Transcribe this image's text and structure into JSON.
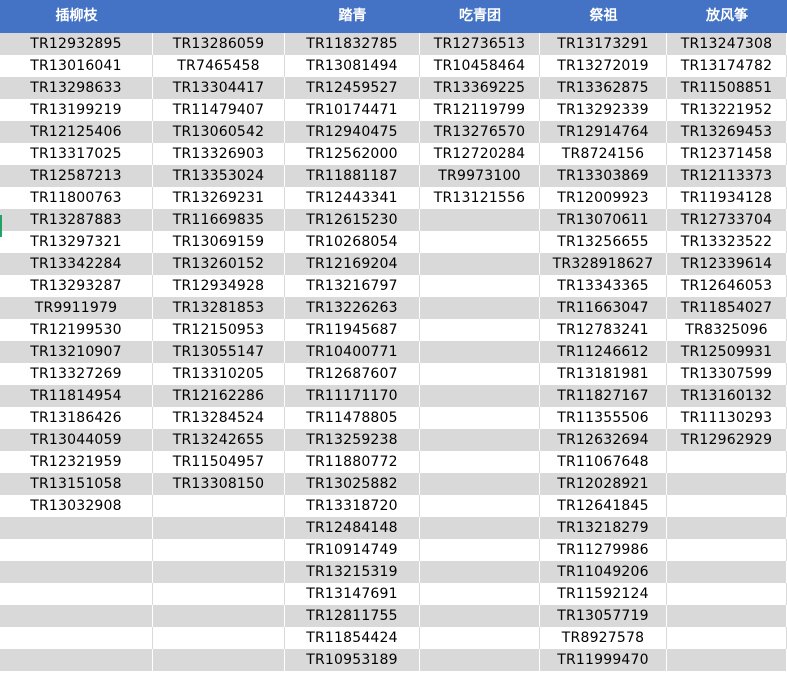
{
  "sheet": {
    "headers": [
      "插柳枝",
      "",
      "踏青",
      "吃青团",
      "祭祖",
      "放风筝"
    ],
    "columns": [
      [
        "TR12932895",
        "TR13016041",
        "TR13298633",
        "TR13199219",
        "TR12125406",
        "TR13317025",
        "TR12587213",
        "TR11800763",
        "TR13287883",
        "TR13297321",
        "TR13342284",
        "TR13293287",
        "TR9911979",
        "TR12199530",
        "TR13210907",
        "TR13327269",
        "TR11814954",
        "TR13186426",
        "TR13044059",
        "TR12321959",
        "TR13151058",
        "TR13032908"
      ],
      [
        "TR13286059",
        "TR7465458",
        "TR13304417",
        "TR11479407",
        "TR13060542",
        "TR13326903",
        "TR13353024",
        "TR13269231",
        "TR11669835",
        "TR13069159",
        "TR13260152",
        "TR12934928",
        "TR13281853",
        "TR12150953",
        "TR13055147",
        "TR13310205",
        "TR12162286",
        "TR13284524",
        "TR13242655",
        "TR11504957",
        "TR13308150"
      ],
      [
        "TR11832785",
        "TR13081494",
        "TR12459527",
        "TR10174471",
        "TR12940475",
        "TR12562000",
        "TR11881187",
        "TR12443341",
        "TR12615230",
        "TR10268054",
        "TR12169204",
        "TR13216797",
        "TR13226263",
        "TR11945687",
        "TR10400771",
        "TR12687607",
        "TR11171170",
        "TR11478805",
        "TR13259238",
        "TR11880772",
        "TR13025882",
        "TR13318720",
        "TR12484148",
        "TR10914749",
        "TR13215319",
        "TR13147691",
        "TR12811755",
        "TR11854424",
        "TR10953189"
      ],
      [
        "TR12736513",
        "TR10458464",
        "TR13369225",
        "TR12119799",
        "TR13276570",
        "TR12720284",
        "TR9973100",
        "TR13121556"
      ],
      [
        "TR13173291",
        "TR13272019",
        "TR13362875",
        "TR13292339",
        "TR12914764",
        "TR8724156",
        "TR13303869",
        "TR12009923",
        "TR13070611",
        "TR13256655",
        "TR328918627",
        "TR13343365",
        "TR11663047",
        "TR12783241",
        "TR11246612",
        "TR13181981",
        "TR11827167",
        "TR11355506",
        "TR12632694",
        "TR11067648",
        "TR12028921",
        "TR12641845",
        "TR13218279",
        "TR11279986",
        "TR11049206",
        "TR11592124",
        "TR13057719",
        "TR8927578",
        "TR11999470"
      ],
      [
        "TR13247308",
        "TR13174782",
        "TR11508851",
        "TR13221952",
        "TR13269453",
        "TR12371458",
        "TR12113373",
        "TR11934128",
        "TR12733704",
        "TR13323522",
        "TR12339614",
        "TR12646053",
        "TR11854027",
        "TR8325096",
        "TR12509931",
        "TR13307599",
        "TR13160132",
        "TR11130293",
        "TR12962929"
      ]
    ]
  },
  "colors": {
    "header_bg": "#4472c4",
    "band": "#d9d9d9",
    "selection": "#21a366"
  }
}
